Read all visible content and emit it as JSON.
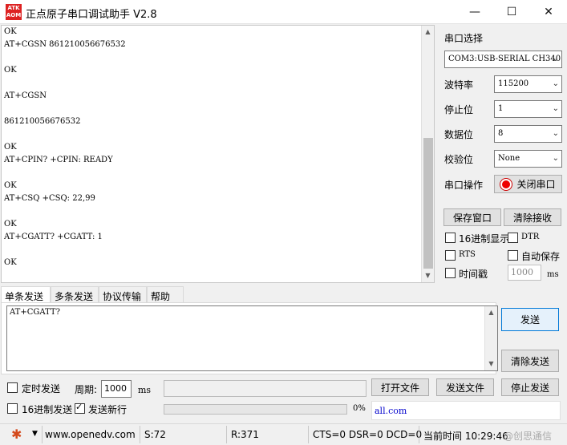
{
  "window": {
    "logo_text": "ATK ALIENTEK",
    "title": "正点原子串口调试助手 V2.8",
    "minimize": "—",
    "maximize": "☐",
    "close": "✕"
  },
  "receive": {
    "text": "OK\nAT+CGSN 861210056676532\n\nOK\n\nAT+CGSN\n\n861210056676532\n\nOK\nAT+CPIN? +CPIN: READY\n\nOK\nAT+CSQ +CSQ: 22,99\n\nOK\nAT+CGATT? +CGATT: 1\n\nOK"
  },
  "settings": {
    "port_label": "串口选择",
    "port_value": "COM3:USB-SERIAL CH340",
    "baud_label": "波特率",
    "baud_value": "115200",
    "stopbit_label": "停止位",
    "stopbit_value": "1",
    "databit_label": "数据位",
    "databit_value": "8",
    "parity_label": "校验位",
    "parity_value": "None",
    "operation_label": "串口操作",
    "close_port_label": "关闭串口",
    "save_window_label": "保存窗口",
    "clear_receive_label": "清除接收",
    "hex_display_label": "16进制显示",
    "dtr_label": "DTR",
    "rts_label": "RTS",
    "auto_save_label": "自动保存",
    "timestamp_label": "时间戳",
    "timestamp_value": "1000",
    "timestamp_unit": "ms"
  },
  "tabs": [
    "单条发送",
    "多条发送",
    "协议传输",
    "帮助"
  ],
  "send": {
    "text": "AT+CGATT?",
    "send_label": "发送",
    "clear_send_label": "清除发送",
    "timed_send_label": "定时发送",
    "period_label": "周期:",
    "period_value": "1000",
    "period_unit": "ms",
    "open_file_label": "打开文件",
    "send_file_label": "发送文件",
    "stop_send_label": "停止发送",
    "hex_send_label": "16进制发送",
    "send_newline_label": "发送新行",
    "progress_text": "0%",
    "progress": 0,
    "link_text": "all.com"
  },
  "status": {
    "website": "www.openedv.com",
    "sent": "S:72",
    "received": "R:371",
    "signals": "CTS=0 DSR=0 DCD=0",
    "time": "当前时间 10:29:46",
    "watermark": "@创思通信"
  }
}
